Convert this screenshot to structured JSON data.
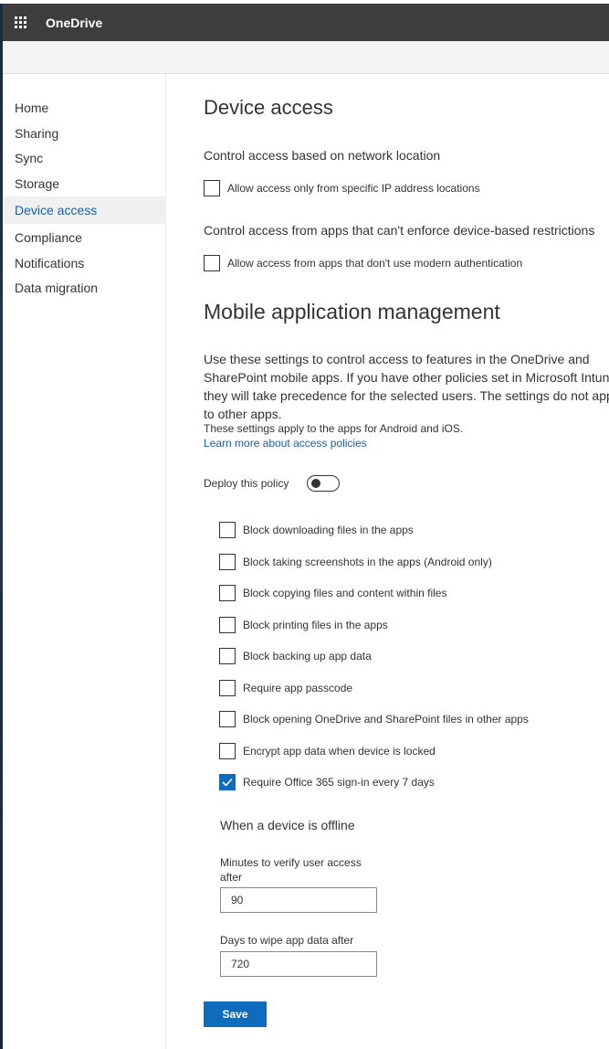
{
  "app": {
    "title": "OneDrive"
  },
  "sidebar": {
    "items": [
      {
        "label": "Home"
      },
      {
        "label": "Sharing"
      },
      {
        "label": "Sync"
      },
      {
        "label": "Storage"
      },
      {
        "label": "Device access",
        "active": true
      },
      {
        "label": "Compliance"
      },
      {
        "label": "Notifications"
      },
      {
        "label": "Data migration"
      }
    ]
  },
  "main": {
    "title": "Device access",
    "network": {
      "label": "Control access based on network location",
      "checkbox_label": "Allow access only from specific IP address locations",
      "checked": false
    },
    "apps": {
      "label": "Control access from apps that can't enforce device-based restrictions",
      "checkbox_label": "Allow access from apps that don't use modern authentication",
      "checked": false
    },
    "mam": {
      "title": "Mobile application management",
      "description": "Use these settings to control access to features in the OneDrive and SharePoint mobile apps. If you have other policies set in Microsoft Intune, they will take precedence for the selected users. The settings do not apply to other apps.",
      "note": "These settings apply to the apps for Android and iOS.",
      "learn_more": "Learn more about access policies",
      "deploy_label": "Deploy this policy",
      "deploy_on": false,
      "options": [
        {
          "label": "Block downloading files in the apps",
          "checked": false
        },
        {
          "label": "Block taking screenshots in the apps (Android only)",
          "checked": false
        },
        {
          "label": "Block copying files and content within files",
          "checked": false
        },
        {
          "label": "Block printing files in the apps",
          "checked": false
        },
        {
          "label": "Block backing up app data",
          "checked": false
        },
        {
          "label": "Require app passcode",
          "checked": false
        },
        {
          "label": "Block opening OneDrive and SharePoint files in other apps",
          "checked": false
        },
        {
          "label": "Encrypt app data when device is locked",
          "checked": false
        },
        {
          "label": "Require Office 365 sign-in every 7 days",
          "checked": true
        }
      ],
      "offline": {
        "title": "When a device is offline",
        "verify_label": "Minutes to verify user access after",
        "verify_value": "90",
        "wipe_label": "Days to wipe app data after",
        "wipe_value": "720"
      },
      "save_label": "Save"
    }
  },
  "colors": {
    "accent": "#0f6cbd",
    "suitebar": "#3d3d3d",
    "link": "#1a5fa8"
  }
}
